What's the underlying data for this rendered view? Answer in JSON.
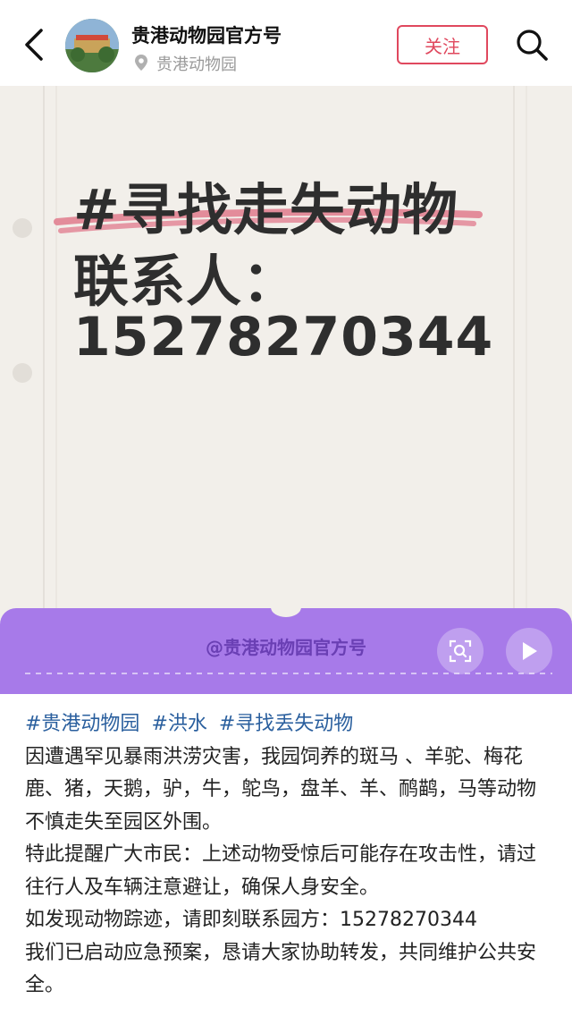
{
  "header": {
    "account_name": "贵港动物园官方号",
    "location": "贵港动物园",
    "follow_label": "关注"
  },
  "poster": {
    "line1": "#寻找走失动物",
    "line2": "联系人：",
    "line3": "15278270344"
  },
  "watermark": "@贵港动物园官方号",
  "caption": {
    "tags": [
      "#贵港动物园",
      "#洪水",
      "#寻找丢失动物"
    ],
    "paragraph1": "因遭遇罕见暴雨洪涝灾害，我园饲养的斑马 、羊驼、梅花鹿、猪，天鹅，驴，牛，鸵鸟，盘羊、羊、鸸鹋，马等动物不慎走失至园区外围。",
    "paragraph2": "特此提醒广大市民：上述动物受惊后可能存在攻击性，请过往行人及车辆注意避让，确保人身安全。",
    "paragraph3": "如发现动物踪迹，请即刻联系园方：15278270344",
    "paragraph4": "我们已启动应急预案，恳请大家协助转发，共同维护公共安全。"
  },
  "colors": {
    "accent": "#e0485e",
    "tag": "#2a5f9e",
    "bar": "#a77ae9"
  },
  "icons": [
    "back-arrow-icon",
    "location-pin-icon",
    "search-icon",
    "image-search-icon",
    "play-icon"
  ]
}
